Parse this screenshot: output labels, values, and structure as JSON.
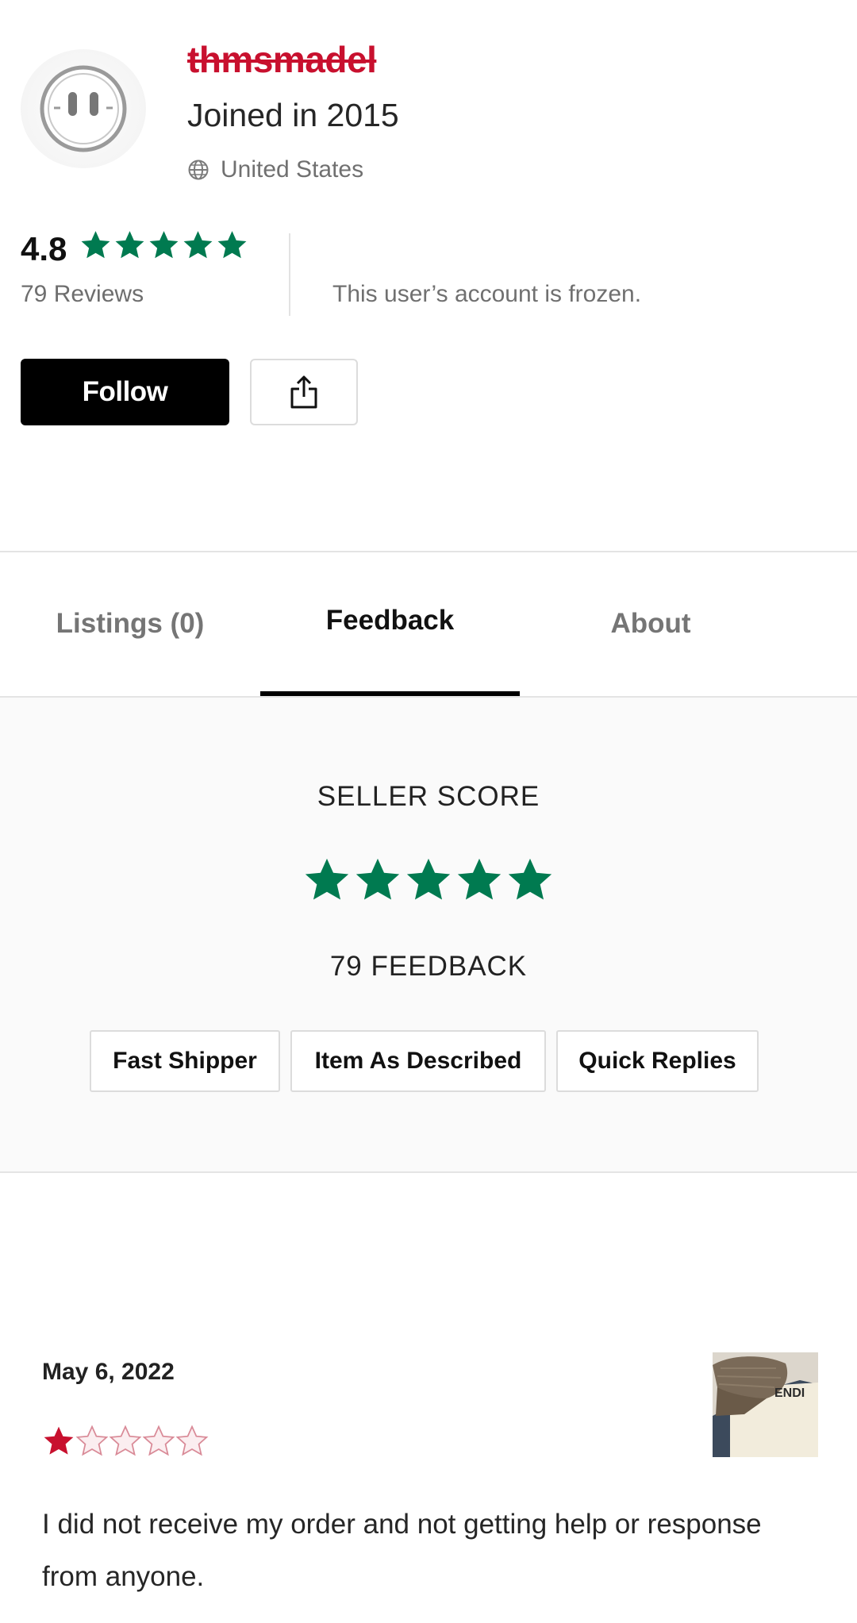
{
  "profile": {
    "username": "thmsmadel",
    "joined": "Joined in 2015",
    "location": "United States",
    "location_icon": "globe-icon",
    "rating": "4.8",
    "reviews": "79 Reviews",
    "frozen_notice": "This user’s account is frozen.",
    "avatar_icon": "smiley-face-icon"
  },
  "actions": {
    "follow_label": "Follow",
    "share_icon": "share-icon"
  },
  "tabs": [
    {
      "label": "Listings (0)",
      "active": false
    },
    {
      "label": "Feedback",
      "active": true
    },
    {
      "label": "About",
      "active": false
    }
  ],
  "seller_score": {
    "title": "SELLER SCORE",
    "stars": 5,
    "feedback_count": "79 FEEDBACK",
    "chips": [
      "Fast Shipper",
      "Item As Described",
      "Quick Replies"
    ]
  },
  "review": {
    "date": "May 6, 2022",
    "rating": 1,
    "max_rating": 5,
    "text": "I did not receive my order and not getting help or response from anyone.",
    "thumb_text": "ENDI"
  },
  "colors": {
    "star_green": "#007a50",
    "star_red": "#c8102e",
    "username_red": "#c8102e"
  }
}
